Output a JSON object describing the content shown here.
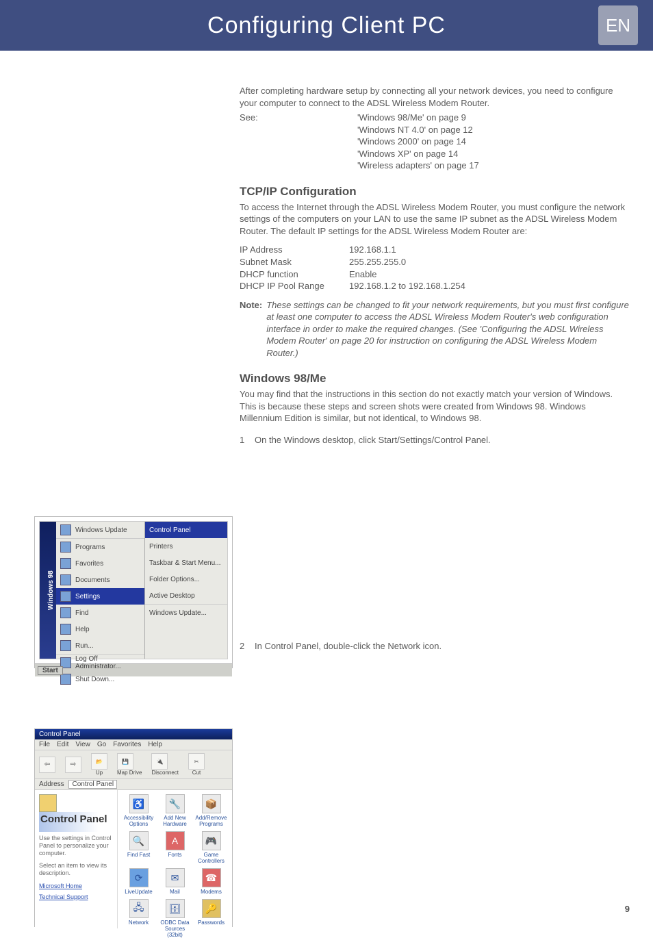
{
  "header": {
    "title": "Configuring Client PC",
    "lang": "EN"
  },
  "intro": {
    "p1": "After completing hardware setup by connecting all your network devices, you need to configure your computer to connect to the ADSL Wireless Modem Router.",
    "see_label": "See:",
    "see_items": [
      "'Windows 98/Me' on page 9",
      "'Windows NT 4.0' on page 12",
      "'Windows 2000' on page 14",
      "'Windows XP' on page 14",
      "'Wireless adapters' on page 17"
    ]
  },
  "tcpip": {
    "heading": "TCP/IP Configuration",
    "p1": "To access the Internet through the ADSL Wireless Modem Router, you must configure the network settings of the computers on your LAN to use the same IP subnet as the ADSL Wireless Modem Router. The default IP settings for the ADSL Wireless Modem Router are:",
    "rows": [
      {
        "label": "IP Address",
        "value": "192.168.1.1"
      },
      {
        "label": "Subnet Mask",
        "value": "255.255.255.0"
      },
      {
        "label": "DHCP function",
        "value": "Enable"
      },
      {
        "label": "DHCP IP Pool Range",
        "value": "192.168.1.2 to 192.168.1.254"
      }
    ],
    "note_label": "Note:",
    "note_body": "These settings can be changed to fit your network requirements, but you must first configure at least one computer to access the ADSL Wireless Modem Router's web configuration interface in order to make the required changes. (See 'Configuring the ADSL Wireless Modem Router' on page 20 for instruction on configuring the ADSL Wireless Modem Router.)"
  },
  "win98": {
    "heading": "Windows 98/Me",
    "p1": "You may find that the instructions in this section do not exactly match your version of Windows. This is because these steps and screen shots were created from Windows 98. Windows Millennium Edition is similar, but not identical, to Windows 98.",
    "step1_num": "1",
    "step1_text": "On the Windows desktop, click Start/Settings/Control Panel.",
    "step2_num": "2",
    "step2_text": "In Control Panel, double-click the Network icon."
  },
  "start_menu": {
    "brand": "Windows 98",
    "items": [
      "Windows Update",
      "Programs",
      "Favorites",
      "Documents",
      "Settings",
      "Find",
      "Help",
      "Run...",
      "Log Off Administrator...",
      "Shut Down..."
    ],
    "sel_index": 4,
    "sub_items": [
      "Control Panel",
      "Printers",
      "Taskbar & Start Menu...",
      "Folder Options...",
      "Active Desktop",
      "Windows Update..."
    ],
    "sub_sel_index": 0,
    "start_label": "Start"
  },
  "control_panel": {
    "title": "Control Panel",
    "menus": [
      "File",
      "Edit",
      "View",
      "Go",
      "Favorites",
      "Help"
    ],
    "tool_labels": [
      "Back",
      "Forward",
      "Up",
      "Map Drive",
      "Disconnect",
      "Cut"
    ],
    "addr_label": "Address",
    "addr_value": "Control Panel",
    "left_heading": "Control Panel",
    "left_text1": "Use the settings in Control Panel to personalize your computer.",
    "left_text2": "Select an item to view its description.",
    "left_link1": "Microsoft Home",
    "left_link2": "Technical Support",
    "icons": [
      [
        "Accessibility Options",
        "Add New Hardware",
        "Add/Remove Programs"
      ],
      [
        "Find Fast",
        "Fonts",
        "Game Controllers"
      ],
      [
        "LiveUpdate",
        "Mail",
        "Modems"
      ],
      [
        "Network",
        "ODBC Data Sources (32bit)",
        "Passwords"
      ]
    ]
  },
  "page_number": "9"
}
